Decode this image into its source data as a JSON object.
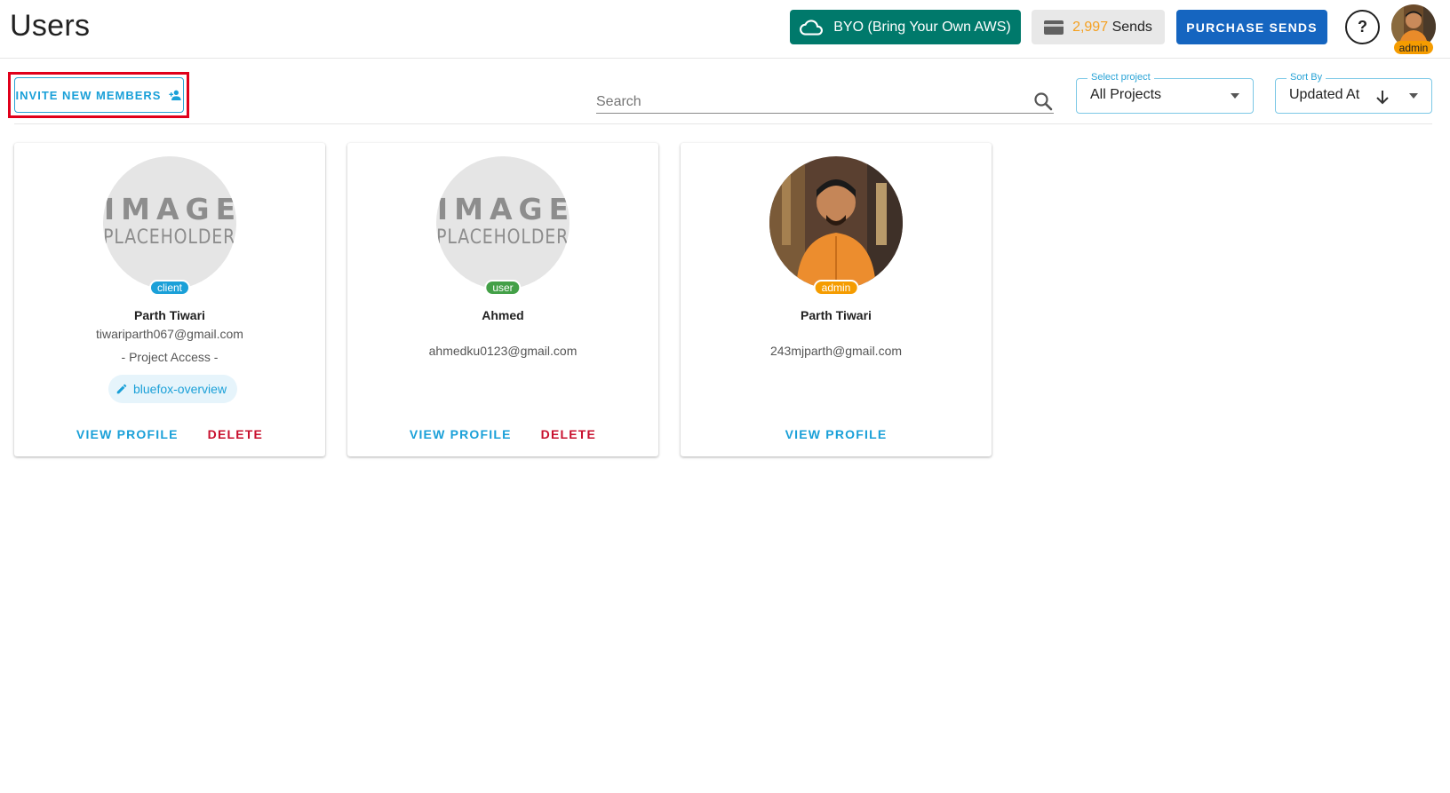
{
  "header": {
    "title": "Users",
    "byo_label": "BYO (Bring Your Own AWS)",
    "sends_count": "2,997",
    "sends_label": "Sends",
    "purchase_label": "PURCHASE SENDS",
    "help_label": "?",
    "current_user_role": "admin"
  },
  "toolbar": {
    "invite_label": "INVITE NEW MEMBERS",
    "search_placeholder": "Search",
    "project_select": {
      "legend": "Select project",
      "value": "All Projects"
    },
    "sort_select": {
      "legend": "Sort By",
      "value": "Updated At"
    }
  },
  "users": [
    {
      "name": "Parth Tiwari",
      "email": "tiwariparth067@gmail.com",
      "role": "client",
      "avatar": "placeholder",
      "placeholder_line1": "IMAGE",
      "placeholder_line2": "PLACEHOLDER",
      "access_label": "- Project Access -",
      "projects": [
        "bluefox-overview"
      ],
      "view_label": "VIEW PROFILE",
      "delete_label": "DELETE"
    },
    {
      "name": "Ahmed",
      "email": "ahmedku0123@gmail.com",
      "role": "user",
      "avatar": "placeholder",
      "placeholder_line1": "IMAGE",
      "placeholder_line2": "PLACEHOLDER",
      "view_label": "VIEW PROFILE",
      "delete_label": "DELETE"
    },
    {
      "name": "Parth Tiwari",
      "email": "243mjparth@gmail.com",
      "role": "admin",
      "avatar": "photo",
      "view_label": "VIEW PROFILE"
    }
  ],
  "colors": {
    "byo_green": "#00796b",
    "purchase_blue": "#1565c0",
    "accent": "#1aa0d8",
    "delete_red": "#c8102e",
    "sends_orange": "#f5a020",
    "badge_client": "#1aa0d8",
    "badge_user": "#43a047",
    "badge_admin": "#f59c00",
    "highlight_red": "#e0001b"
  },
  "icons": {
    "byo": "cloud-icon",
    "sends": "credit-card-icon",
    "invite": "person-add-icon",
    "search": "search-icon",
    "sort": "arrow-down-icon",
    "select": "caret-down-icon",
    "chip": "pencil-icon"
  }
}
